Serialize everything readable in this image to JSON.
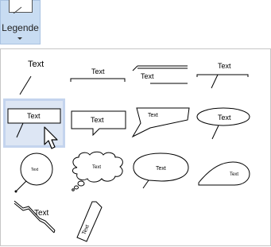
{
  "ribbon": {
    "label": "Legende"
  },
  "callouts": [
    {
      "name": "line-callout",
      "text": "Text"
    },
    {
      "name": "bracket-callout",
      "text": "Text"
    },
    {
      "name": "double-line-callout",
      "text": "Text"
    },
    {
      "name": "tick-line-callout",
      "text": "Text"
    },
    {
      "name": "rectangle-callout",
      "text": "Text"
    },
    {
      "name": "speech-rectangle-callout",
      "text": "Text"
    },
    {
      "name": "slanted-callout",
      "text": "Text"
    },
    {
      "name": "ellipse-line-callout",
      "text": "Text"
    },
    {
      "name": "circle-line-callout",
      "text": "Text"
    },
    {
      "name": "cloud-callout",
      "text": "Text"
    },
    {
      "name": "oval-speech-callout",
      "text": "Text"
    },
    {
      "name": "teardrop-callout",
      "text": "Text"
    },
    {
      "name": "zigzag-callout",
      "text": "Text"
    },
    {
      "name": "tag-callout",
      "text": "Text"
    }
  ],
  "selected_index": 4
}
